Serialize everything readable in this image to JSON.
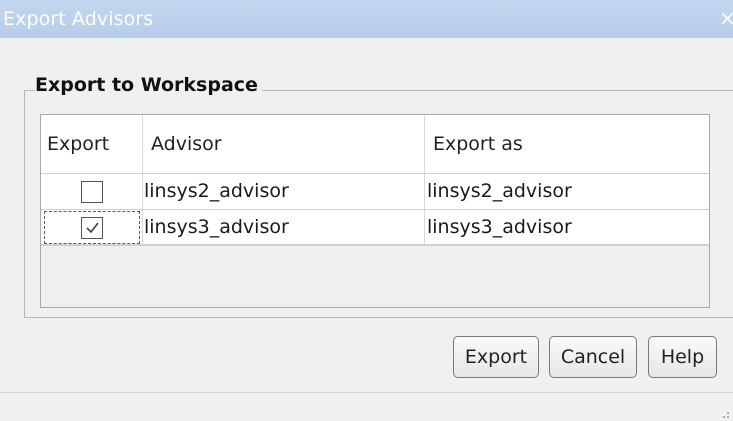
{
  "window": {
    "title": "Export Advisors",
    "close_glyph": "×"
  },
  "group": {
    "label": "Export to Workspace"
  },
  "table": {
    "columns": [
      "Export",
      "Advisor",
      "Export as"
    ],
    "rows": [
      {
        "checked": false,
        "advisor": "linsys2_advisor",
        "export_as": "linsys2_advisor"
      },
      {
        "checked": true,
        "advisor": "linsys3_advisor",
        "export_as": "linsys3_advisor"
      }
    ]
  },
  "buttons": {
    "export": "Export",
    "cancel": "Cancel",
    "help": "Help"
  },
  "colors": {
    "titlebar": "#b9cfea",
    "title_text": "#ffffff",
    "window_bg": "#f0f0f0"
  }
}
